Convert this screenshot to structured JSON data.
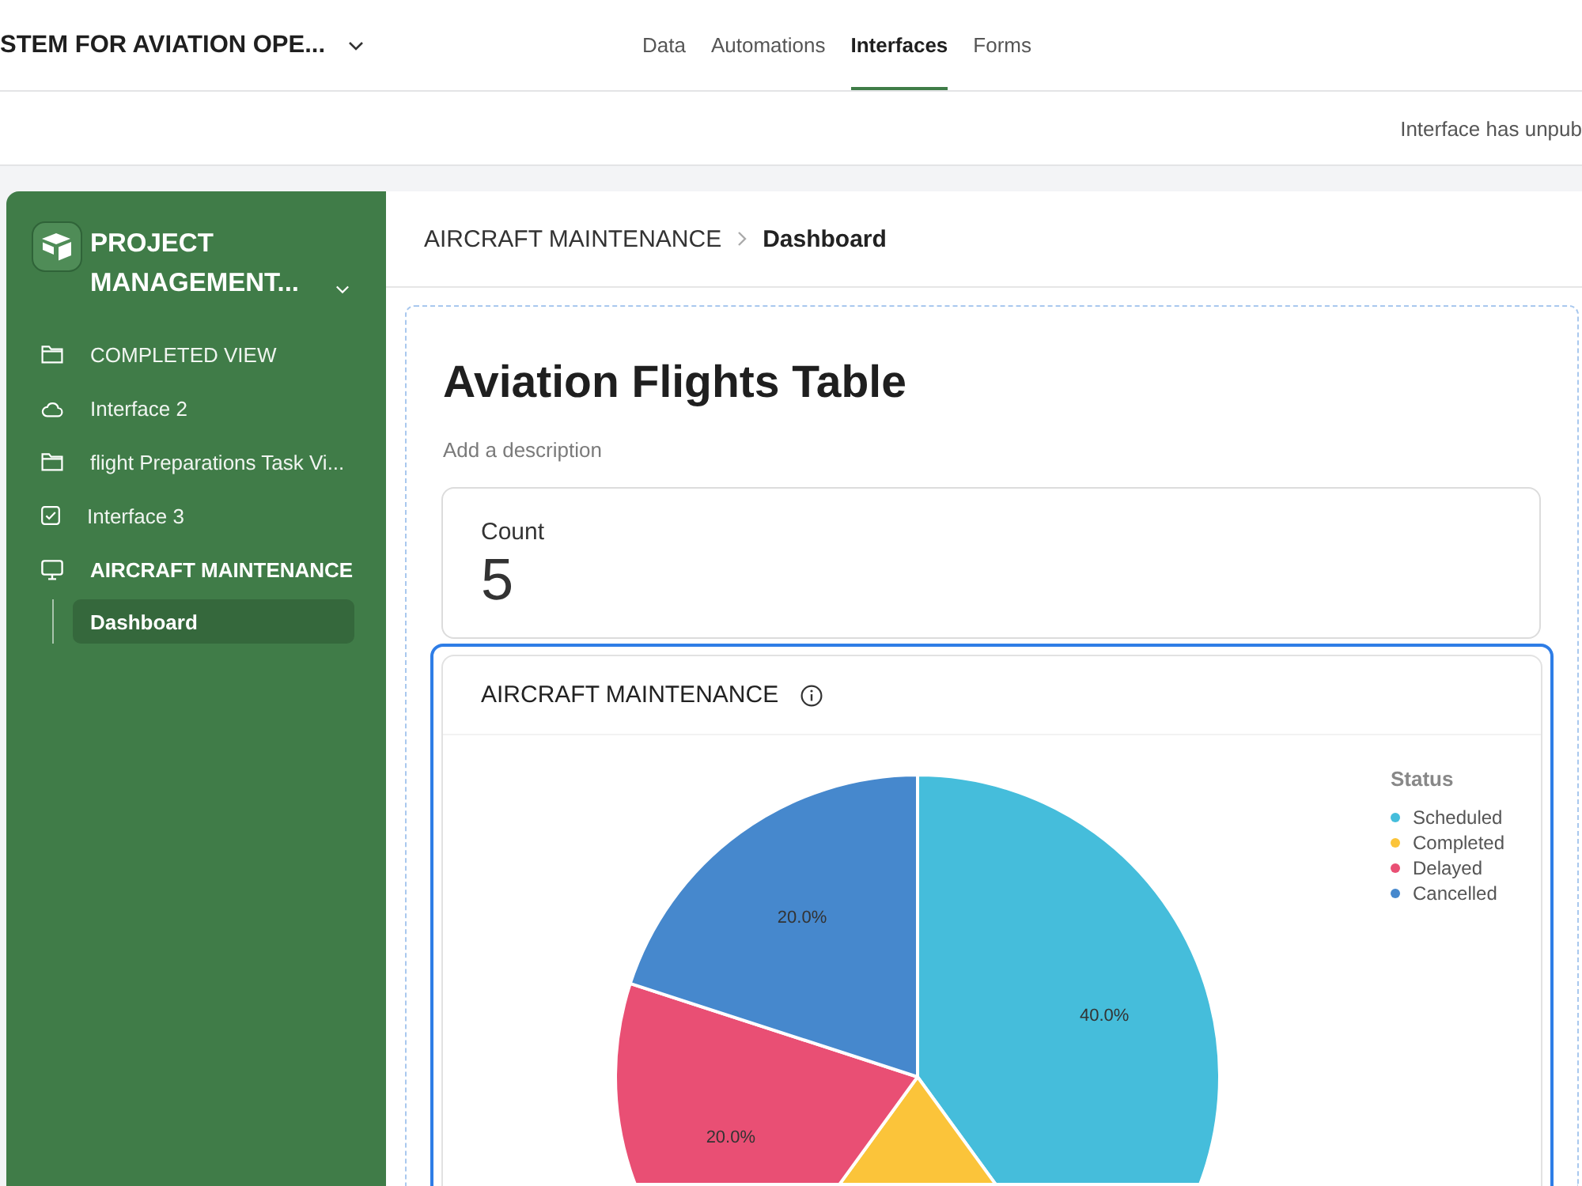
{
  "top_bar": {
    "title": "STEM FOR AVIATION OPE...",
    "tabs": [
      {
        "label": "Data",
        "selected": false
      },
      {
        "label": "Automations",
        "selected": false
      },
      {
        "label": "Interfaces",
        "selected": true
      },
      {
        "label": "Forms",
        "selected": false
      }
    ]
  },
  "status_bar": {
    "message": "Interface has unpub"
  },
  "sidebar": {
    "title": "PROJECT MANAGEMENT...",
    "items": [
      {
        "label": "COMPLETED VIEW",
        "kind": "folder",
        "selected": false,
        "expanded": false
      },
      {
        "label": "Interface 2",
        "kind": "cloud",
        "selected": false,
        "expanded": false
      },
      {
        "label": "flight Preparations Task Vi...",
        "kind": "folder",
        "selected": false,
        "expanded": false
      },
      {
        "label": "Interface 3",
        "kind": "check",
        "selected": false,
        "expanded": false
      },
      {
        "label": "AIRCRAFT MAINTENANCE",
        "kind": "monitor",
        "selected": false,
        "expanded": true,
        "children": [
          {
            "label": "Dashboard",
            "selected": true
          }
        ]
      }
    ]
  },
  "breadcrumb": [
    "AIRCRAFT MAINTENANCE",
    "Dashboard"
  ],
  "page": {
    "title": "Aviation Flights Table",
    "description": {
      "placeholder": "Add a description"
    },
    "count_card": {
      "label": "Count",
      "value": "5"
    },
    "chart_card": {
      "title": "AIRCRAFT MAINTENANCE",
      "selected": true,
      "chart_data": {
        "type": "pie",
        "legend_title": "Status",
        "categories": [
          "Scheduled",
          "Completed",
          "Delayed",
          "Cancelled"
        ],
        "values": [
          40,
          20,
          20,
          20
        ],
        "colors": [
          "#45bddb",
          "#fbc43a",
          "#e94f74",
          "#4688cd"
        ],
        "value_labels": [
          "40.0%",
          null,
          "20.0%",
          "20.0%"
        ]
      }
    }
  }
}
